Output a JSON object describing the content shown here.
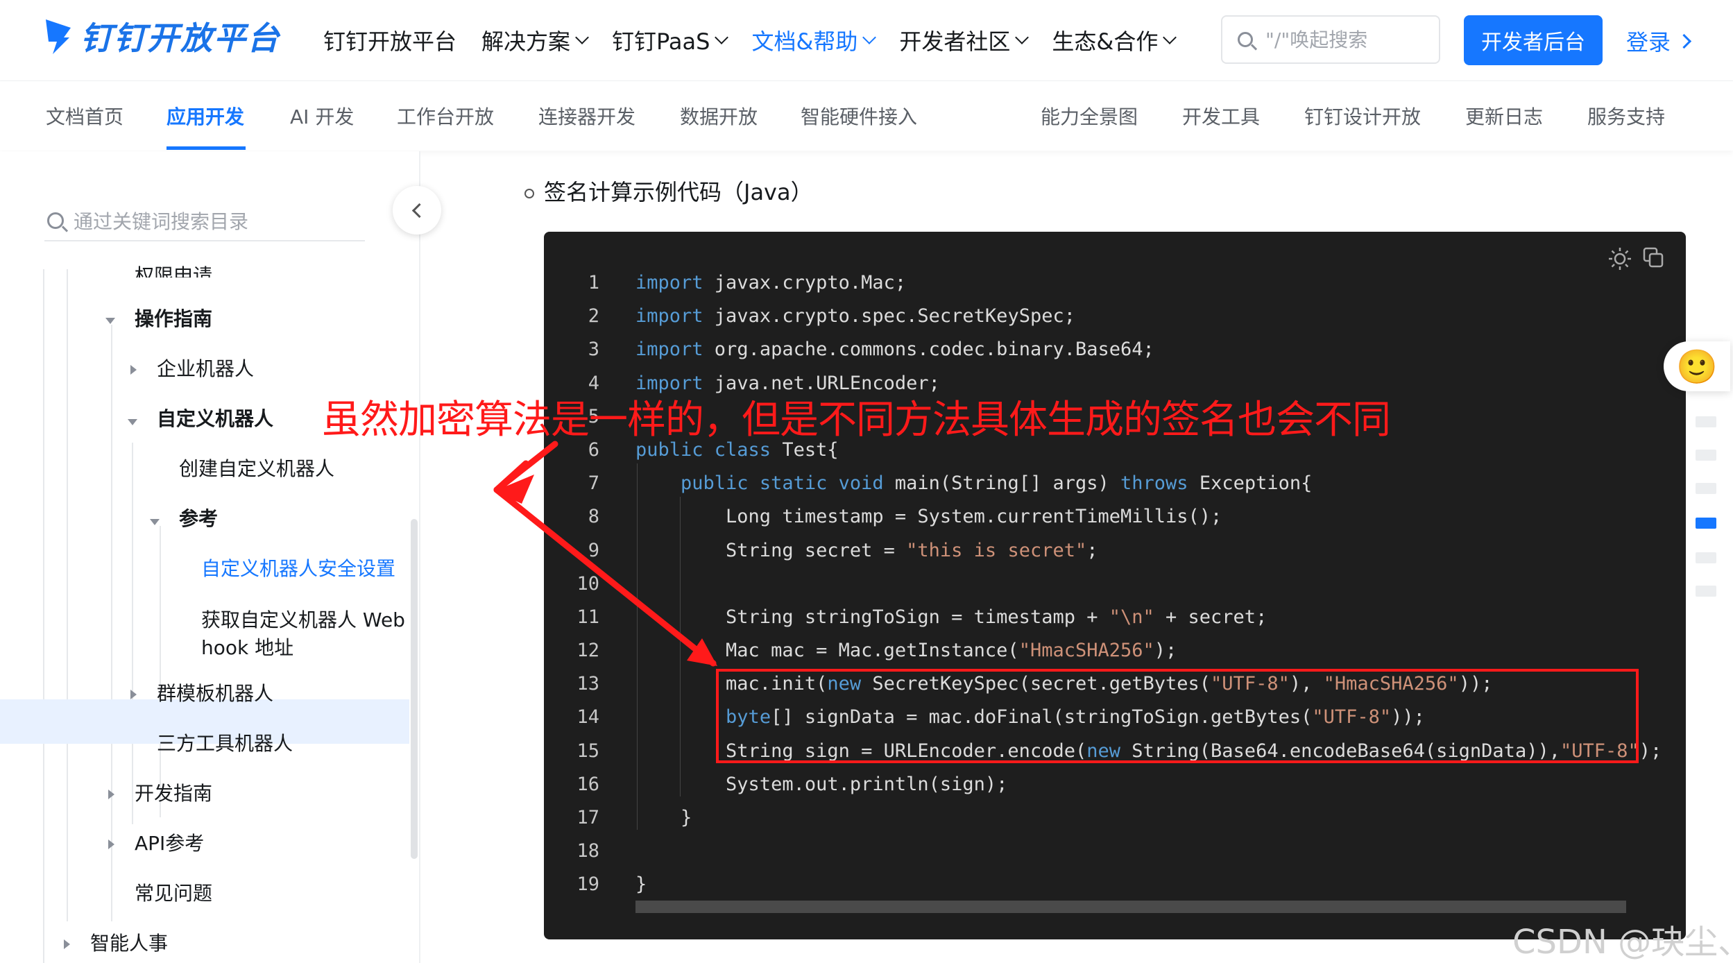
{
  "header": {
    "logo_text": "钉钉开放平台",
    "nav": [
      {
        "label": "钉钉开放平台",
        "dropdown": false,
        "active": false
      },
      {
        "label": "解决方案",
        "dropdown": true,
        "active": false
      },
      {
        "label": "钉钉PaaS",
        "dropdown": true,
        "active": false
      },
      {
        "label": "文档&帮助",
        "dropdown": true,
        "active": true
      },
      {
        "label": "开发者社区",
        "dropdown": true,
        "active": false
      },
      {
        "label": "生态&合作",
        "dropdown": true,
        "active": false
      }
    ],
    "search_placeholder": "\"/\"唤起搜索",
    "dev_console_label": "开发者后台",
    "login_label": "登录",
    "accent_color": "#1677ff"
  },
  "subnav": {
    "items": [
      "文档首页",
      "应用开发",
      "AI 开发",
      "工作台开放",
      "连接器开发",
      "数据开放",
      "智能硬件接入",
      "能力全景图",
      "开发工具",
      "钉钉设计开放",
      "更新日志",
      "服务支持"
    ],
    "active": "应用开发"
  },
  "sidebar": {
    "search_placeholder": "通过关键词搜索目录",
    "items": {
      "cut_top": "权限申请",
      "op_guide": "操作指南",
      "enterprise_bot": "企业机器人",
      "custom_bot": "自定义机器人",
      "create_custom_bot": "创建自定义机器人",
      "reference": "参考",
      "security_settings": "自定义机器人安全设置",
      "webhook_line1": "获取自定义机器人 Web",
      "webhook_line2": "hook 地址",
      "group_template_bot": "群模板机器人",
      "third_party_bot": "三方工具机器人",
      "dev_guide": "开发指南",
      "api_ref": "API参考",
      "faq": "常见问题",
      "smart_hr": "智能人事"
    }
  },
  "main": {
    "section_title": "签名计算示例代码（Java）",
    "code_lines": [
      {
        "n": "1",
        "tokens": [
          [
            "kw",
            "import"
          ],
          [
            "t",
            " javax.crypto.Mac;"
          ]
        ]
      },
      {
        "n": "2",
        "tokens": [
          [
            "kw",
            "import"
          ],
          [
            "t",
            " javax.crypto.spec.SecretKeySpec;"
          ]
        ]
      },
      {
        "n": "3",
        "tokens": [
          [
            "kw",
            "import"
          ],
          [
            "t",
            " org.apache.commons.codec.binary.Base64;"
          ]
        ]
      },
      {
        "n": "4",
        "tokens": [
          [
            "kw",
            "import"
          ],
          [
            "t",
            " java.net.URLEncoder;"
          ]
        ]
      },
      {
        "n": "5",
        "tokens": []
      },
      {
        "n": "6",
        "tokens": [
          [
            "kw",
            "public class"
          ],
          [
            "t",
            " Test{"
          ]
        ]
      },
      {
        "n": "7",
        "tokens": [
          [
            "t",
            "    "
          ],
          [
            "kw",
            "public static void"
          ],
          [
            "t",
            " main(String[] args) "
          ],
          [
            "kw",
            "throws"
          ],
          [
            "t",
            " Exception{"
          ]
        ]
      },
      {
        "n": "8",
        "tokens": [
          [
            "t",
            "        Long timestamp = System.currentTimeMillis();"
          ]
        ]
      },
      {
        "n": "9",
        "tokens": [
          [
            "t",
            "        String secret = "
          ],
          [
            "str",
            "\"this is secret\""
          ],
          [
            "t",
            ";"
          ]
        ]
      },
      {
        "n": "10",
        "tokens": []
      },
      {
        "n": "11",
        "tokens": [
          [
            "t",
            "        String stringToSign = timestamp + "
          ],
          [
            "str",
            "\"\\n\""
          ],
          [
            "t",
            " + secret;"
          ]
        ]
      },
      {
        "n": "12",
        "tokens": [
          [
            "t",
            "        Mac mac = Mac.getInstance("
          ],
          [
            "str",
            "\"HmacSHA256\""
          ],
          [
            "t",
            ");"
          ]
        ]
      },
      {
        "n": "13",
        "tokens": [
          [
            "t",
            "        mac.init("
          ],
          [
            "kw",
            "new"
          ],
          [
            "t",
            " SecretKeySpec(secret.getBytes("
          ],
          [
            "str",
            "\"UTF-8\""
          ],
          [
            "t",
            "), "
          ],
          [
            "str",
            "\"HmacSHA256\""
          ],
          [
            "t",
            "));"
          ]
        ]
      },
      {
        "n": "14",
        "tokens": [
          [
            "t",
            "        "
          ],
          [
            "kw",
            "byte"
          ],
          [
            "t",
            "[] signData = mac.doFinal(stringToSign.getBytes("
          ],
          [
            "str",
            "\"UTF-8\""
          ],
          [
            "t",
            "));"
          ]
        ]
      },
      {
        "n": "15",
        "tokens": [
          [
            "t",
            "        String sign = URLEncoder.encode("
          ],
          [
            "kw",
            "new"
          ],
          [
            "t",
            " String(Base64.encodeBase64(signData)),"
          ],
          [
            "str",
            "\"UTF-8\""
          ],
          [
            "t",
            ");"
          ]
        ]
      },
      {
        "n": "16",
        "tokens": [
          [
            "t",
            "        System.out.println(sign);"
          ]
        ]
      },
      {
        "n": "17",
        "tokens": [
          [
            "t",
            "    }"
          ]
        ]
      },
      {
        "n": "18",
        "tokens": []
      },
      {
        "n": "19",
        "tokens": [
          [
            "t",
            "}"
          ]
        ]
      }
    ]
  },
  "annotation": {
    "text": "虽然加密算法是一样的，但是不同方法具体生成的签名也会不同",
    "color": "#ff1a1a"
  },
  "watermark": "CSDN @玦尘、"
}
